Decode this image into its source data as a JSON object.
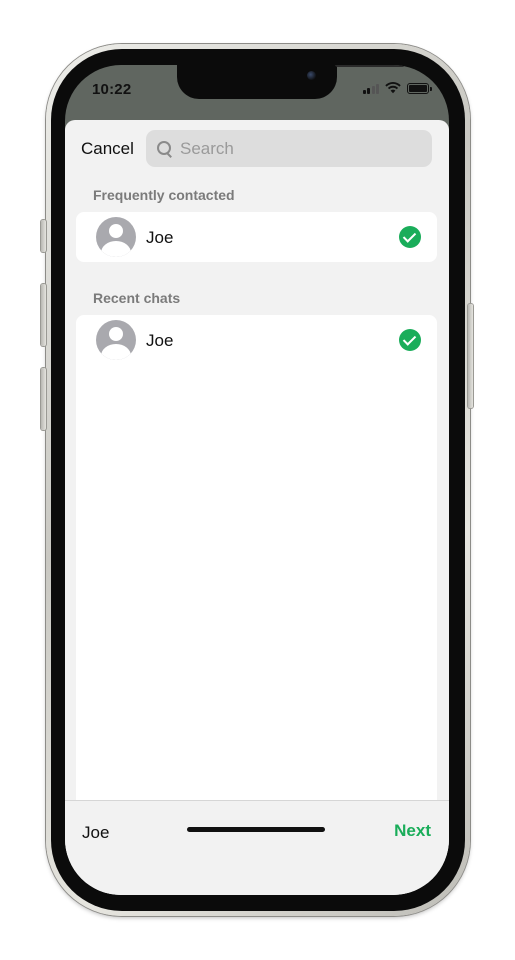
{
  "status_bar": {
    "time": "10:22",
    "icons": [
      "cellular-signal-icon",
      "wifi-icon",
      "battery-icon"
    ]
  },
  "search": {
    "cancel_label": "Cancel",
    "placeholder": "Search",
    "value": ""
  },
  "sections": [
    {
      "title": "Frequently contacted",
      "contacts": [
        {
          "name": "Joe",
          "selected": true
        }
      ]
    },
    {
      "title": "Recent chats",
      "contacts": [
        {
          "name": "Joe",
          "selected": true
        }
      ]
    }
  ],
  "footer": {
    "selected_names": "Joe",
    "next_label": "Next"
  },
  "colors": {
    "accent": "#1aad5a",
    "sheet_background": "#f2f2f2",
    "search_field": "#dddddd",
    "section_header_text": "#7b7b7b"
  }
}
